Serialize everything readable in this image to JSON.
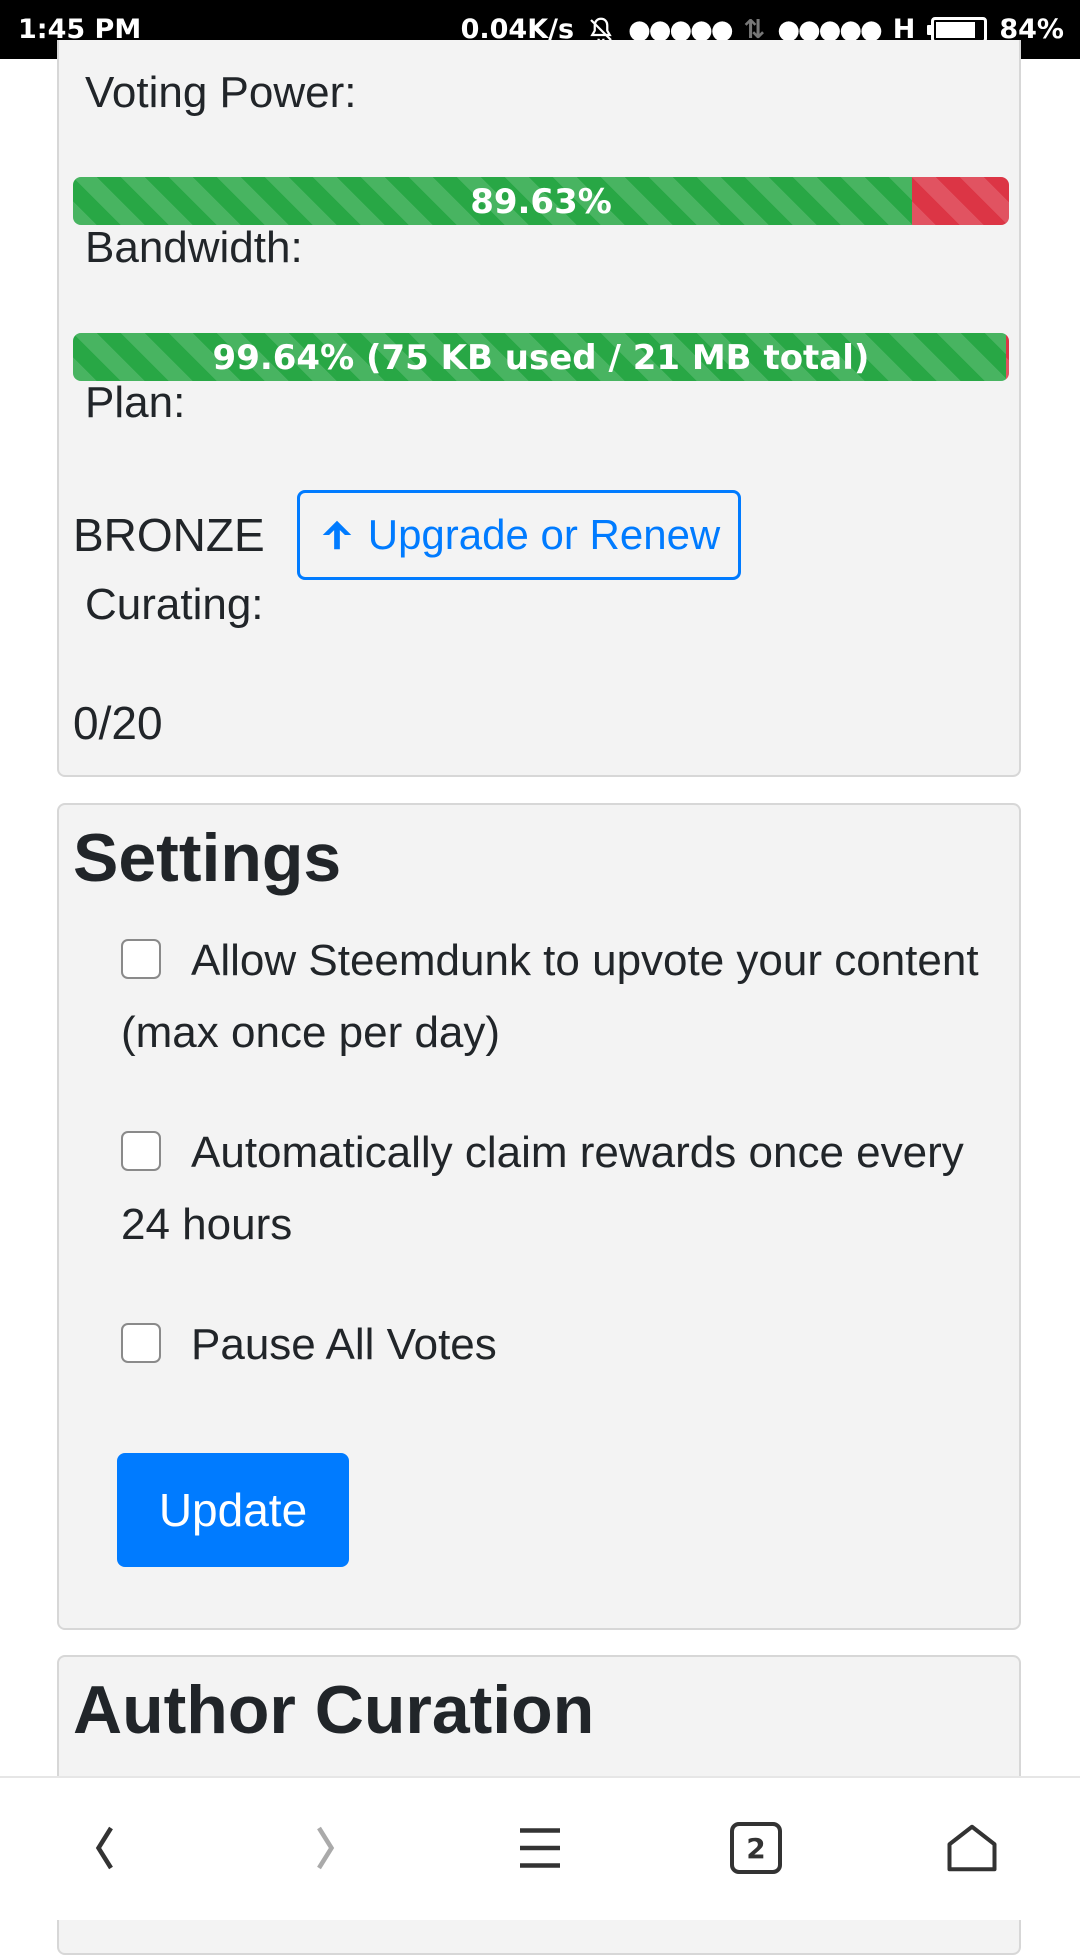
{
  "status_bar": {
    "time": "1:45 PM",
    "net_speed": "0.04K/s",
    "signal1": "●●●●●",
    "signal2": "●●●●●",
    "network_type": "H",
    "battery_percent": "84%",
    "battery_level": 0.84
  },
  "account": {
    "voting_power_label": "Voting Power:",
    "voting_power_text": "89.63%",
    "voting_power_value": 89.63,
    "bandwidth_label": "Bandwidth:",
    "bandwidth_text": "99.64% (75 KB used / 21 MB total)",
    "bandwidth_value": 99.64,
    "plan_label": "Plan:",
    "plan_value": "BRONZE",
    "upgrade_button": "Upgrade or Renew",
    "curating_label": "Curating:",
    "curating_count": "0/20"
  },
  "settings": {
    "title": "Settings",
    "options": [
      {
        "label": "Allow Steemdunk to upvote your content (max once per day)",
        "checked": false
      },
      {
        "label": "Automatically claim rewards once every 24 hours",
        "checked": false
      },
      {
        "label": "Pause All Votes",
        "checked": false
      }
    ],
    "update_button": "Update"
  },
  "author_curation": {
    "title": "Author Curation"
  },
  "bottom_nav": {
    "tab_count": "2",
    "icons": [
      "back-icon",
      "forward-icon",
      "menu-icon",
      "tabs-icon",
      "home-icon"
    ]
  },
  "colors": {
    "primary": "#007bff",
    "success": "#28a745",
    "danger": "#dc3545"
  }
}
